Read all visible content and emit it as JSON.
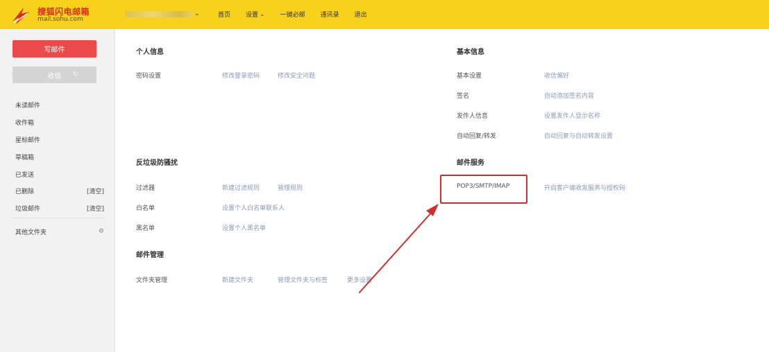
{
  "header": {
    "logo_cn": "搜狐闪电邮箱",
    "logo_en": "mail.sohu.com",
    "account_caret": "⌄",
    "nav": {
      "home": "首页",
      "settings": "设置",
      "settings_caret": "⌄",
      "one_click": "一键必邮",
      "address_book": "通讯录",
      "logout": "退出"
    }
  },
  "sidebar": {
    "write_label": "写邮件",
    "receive_label": "收信",
    "folders": [
      {
        "label": "未读邮件"
      },
      {
        "label": "收件箱"
      },
      {
        "label": "星标邮件"
      },
      {
        "label": "草稿箱"
      },
      {
        "label": "已发送"
      },
      {
        "label": "已删除",
        "action": "[清空]"
      },
      {
        "label": "垃圾邮件",
        "action": "[清空]"
      }
    ],
    "other_folders": "其他文件夹"
  },
  "main": {
    "personal": {
      "title": "个人信息",
      "rows": [
        {
          "label": "密码设置",
          "links": [
            "修改登录密码",
            "修改安全问题"
          ]
        }
      ]
    },
    "basic": {
      "title": "基本信息",
      "rows": [
        {
          "label": "基本设置",
          "value": "收信偏好"
        },
        {
          "label": "签名",
          "value": "自动添加签名内容"
        },
        {
          "label": "发件人信息",
          "value": "设置发件人显示名称"
        },
        {
          "label": "自动回复/转发",
          "value": "自动回复与自动转发设置"
        }
      ]
    },
    "anti_spam": {
      "title": "反垃圾防骚扰",
      "rows": [
        {
          "label": "过滤器",
          "links": [
            "新建过滤规则",
            "管理规则"
          ]
        },
        {
          "label": "白名单",
          "value": "设置个人白名单联系人"
        },
        {
          "label": "黑名单",
          "value": "设置个人黑名单"
        }
      ]
    },
    "mail_service": {
      "title": "邮件服务",
      "rows": [
        {
          "label": "POP3/SMTP/IMAP",
          "value": "开启客户端收发服务与授权码"
        }
      ]
    },
    "mail_manage": {
      "title": "邮件管理",
      "rows": [
        {
          "label": "文件夹管理",
          "links": [
            "新建文件夹",
            "管理文件夹与标签",
            "更多设置"
          ]
        }
      ]
    }
  },
  "colors": {
    "header_bg": "#f8d11b",
    "primary_button": "#ea4a4a",
    "highlight_border": "#d42b2b",
    "link": "#8a9bb5"
  }
}
